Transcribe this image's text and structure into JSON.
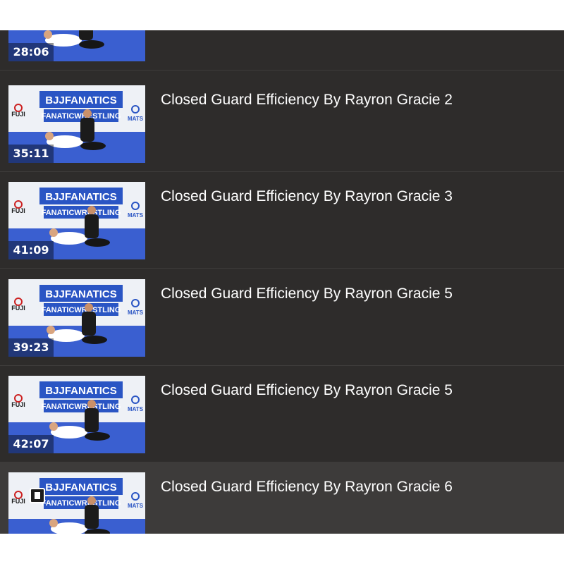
{
  "colors": {
    "panel_bg": "#2e2c2b",
    "active_row_bg": "#3d3b3a",
    "brand_blue": "#2a55c4",
    "mat_blue": "#3a5fd0"
  },
  "thumbnail_text": {
    "brand": "BJJFANATICS",
    "sub": "FANATICWRESTLING",
    "sponsor": "FUJI",
    "sponsor_sub": "MATS"
  },
  "playlist": {
    "items": [
      {
        "title": "",
        "duration": "28:06",
        "active": false
      },
      {
        "title": "Closed Guard Efficiency By Rayron Gracie 2",
        "duration": "35:11",
        "active": false
      },
      {
        "title": "Closed Guard Efficiency By Rayron Gracie 3",
        "duration": "41:09",
        "active": false
      },
      {
        "title": "Closed Guard Efficiency By Rayron Gracie 5",
        "duration": "39:23",
        "active": false
      },
      {
        "title": "Closed Guard Efficiency By Rayron Gracie 5",
        "duration": "42:07",
        "active": false
      },
      {
        "title": "Closed Guard Efficiency By Rayron Gracie 6",
        "duration": "",
        "active": true,
        "icon": "pause-icon"
      }
    ]
  }
}
